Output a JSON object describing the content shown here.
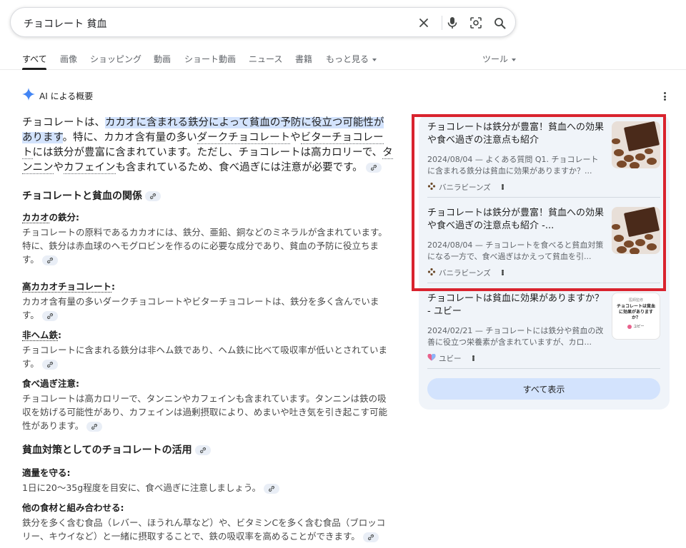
{
  "search": {
    "query": "チョコレート 貧血"
  },
  "tabs": [
    {
      "label": "すべて"
    },
    {
      "label": "画像"
    },
    {
      "label": "ショッピング"
    },
    {
      "label": "動画"
    },
    {
      "label": "ショート動画"
    },
    {
      "label": "ニュース"
    },
    {
      "label": "書籍"
    },
    {
      "label": "もっと見る"
    },
    {
      "label": "ツール"
    }
  ],
  "ai_overview": {
    "label": "AI による概要",
    "intro": {
      "p1": "チョコレートは、",
      "highlight": "カカオに含まれる鉄分によって貧血の予防に役立つ可能性があります",
      "p2": "。特に、カカオ含有量の多い",
      "term1": "ダークチョコレート",
      "p3": "や",
      "term2": "ビターチョコレート",
      "p4": "には鉄分が豊富に含まれています。ただし、チョコレートは高カロリーで、",
      "term3": "タンニン",
      "p5": "や",
      "term4": "カフェイン",
      "p6": "も含まれているため、食べ過ぎには注意が必要です。"
    },
    "section1": {
      "heading": "チョコレートと貧血の関係",
      "items": [
        {
          "term": "カカオ",
          "suffix": "の鉄分:",
          "text": "チョコレートの原料であるカカオには、鉄分、亜鉛、銅などのミネラルが含まれています。特に、鉄分は赤血球のヘモグロビンを作るのに必要な成分であり、貧血の予防に役立ちます。"
        },
        {
          "term": "高カカオチョコレート",
          "suffix": ":",
          "text": "カカオ含有量の多いダークチョコレートやビターチョコレートは、鉄分を多く含んでいます。"
        },
        {
          "term": "非ヘム鉄",
          "suffix": ":",
          "text": "チョコレートに含まれる鉄分は非ヘム鉄であり、ヘム鉄に比べて吸収率が低いとされています。"
        },
        {
          "term": "",
          "suffix": "食べ過ぎ注意:",
          "text": "チョコレートは高カロリーで、タンニンやカフェインも含まれています。タンニンは鉄の吸収を妨げる可能性があり、カフェインは過剰摂取により、めまいや吐き気を引き起こす可能性があります。"
        }
      ]
    },
    "section2": {
      "heading": "貧血対策としてのチョコレートの活用",
      "items": [
        {
          "title": "適量を守る:",
          "text": "1日に20〜35g程度を目安に、食べ過ぎに注意しましょう。"
        },
        {
          "title": "他の食材と組み合わせる:",
          "text": "鉄分を多く含む食品（レバー、ほうれん草など）や、ビタミンCを多く含む食品（ブロッコリー、キウイなど）と一緒に摂取することで、鉄の吸収率を高めることができます。"
        }
      ]
    }
  },
  "sources": [
    {
      "title": "チョコレートは鉄分が豊富！貧血への効果や食べ過ぎの注意点も紹介",
      "snippet": "2024/08/04 — よくある質問 Q1. チョコレートに含まれる鉄分は貧血に効果がありますか？...",
      "source": "バニラビーンズ"
    },
    {
      "title": "チョコレートは鉄分が豊富！貧血への効果や食べ過ぎの注意点も紹介 -...",
      "snippet": "2024/08/04 — チョコレートを食べると貧血対策になる一方で、食べ過ぎはかえって貧血を引...",
      "source": "バニラビーンズ"
    },
    {
      "title": "チョコレートは貧血に効果がありますか？ - ユビー",
      "snippet": "2024/02/21 — チョコレートには鉄分や貧血の改善に役立つ栄養素が含まれていますが、カロ...",
      "source": "ユビー",
      "thumb_text": {
        "top": "医師監修",
        "main": "チョコレートは貧血に効果がありますか？",
        "brand": "ユビー"
      }
    }
  ],
  "show_all_label": "すべて表示",
  "colors": {
    "highlight": "#d3e3fd",
    "panel_bg": "#f0f4f9",
    "red_box": "#d9232e",
    "ubie_pink": "#e8618c"
  }
}
